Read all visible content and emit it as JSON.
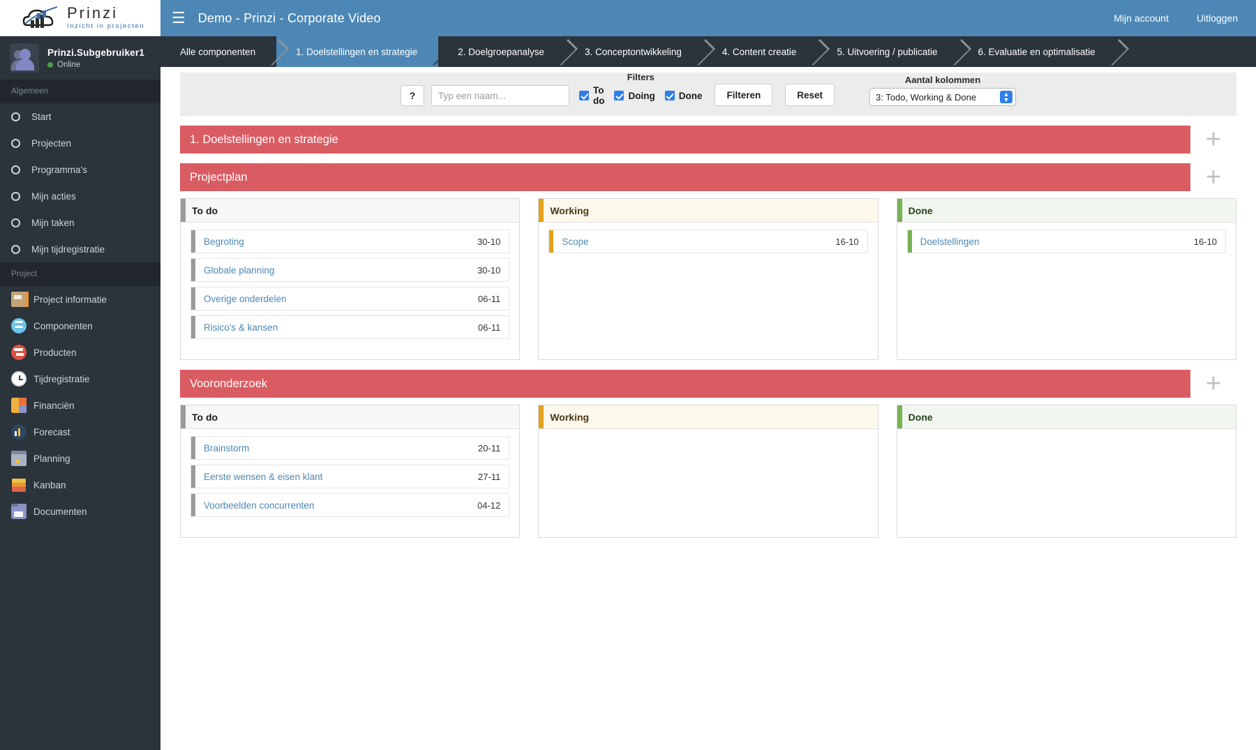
{
  "brand": {
    "title": "Prinzi",
    "tagline": "Inzicht in projecten"
  },
  "user": {
    "name": "Prinzi.Subgebruiker1",
    "status": "Online"
  },
  "topbar": {
    "app_title": "Demo - Prinzi - Corporate Video",
    "menu_icon": "hamburger-icon",
    "account_label": "Mijn account",
    "logout_label": "Uitloggen"
  },
  "sidebar": {
    "group_general_label": "Algemeen",
    "group_project_label": "Project",
    "general_items": [
      {
        "label": "Start",
        "icon": "circle-icon"
      },
      {
        "label": "Projecten",
        "icon": "circle-icon"
      },
      {
        "label": "Programma's",
        "icon": "circle-icon"
      },
      {
        "label": "Mijn acties",
        "icon": "circle-icon"
      },
      {
        "label": "Mijn taken",
        "icon": "circle-icon"
      },
      {
        "label": "Mijn tijdregistratie",
        "icon": "circle-icon"
      }
    ],
    "project_items": [
      {
        "label": "Project informatie",
        "icon": "notebook-icon"
      },
      {
        "label": "Componenten",
        "icon": "components-icon"
      },
      {
        "label": "Producten",
        "icon": "products-icon"
      },
      {
        "label": "Tijdregistratie",
        "icon": "stopwatch-icon"
      },
      {
        "label": "Financiën",
        "icon": "calculator-icon"
      },
      {
        "label": "Forecast",
        "icon": "bar-chart-icon"
      },
      {
        "label": "Planning",
        "icon": "calendar-icon"
      },
      {
        "label": "Kanban",
        "icon": "layers-icon"
      },
      {
        "label": "Documenten",
        "icon": "folder-icon"
      }
    ]
  },
  "breadcrumbs": [
    {
      "label": "Alle componenten",
      "active": false
    },
    {
      "label": "1. Doelstellingen en strategie",
      "active": true
    },
    {
      "label": "2. Doelgroepanalyse",
      "active": false
    },
    {
      "label": "3. Conceptontwikkeling",
      "active": false
    },
    {
      "label": "4. Content creatie",
      "active": false
    },
    {
      "label": "5. Uitvoering / publicatie",
      "active": false
    },
    {
      "label": "6. Evaluatie en optimalisatie",
      "active": false
    }
  ],
  "toolbar": {
    "help_label": "?",
    "search_placeholder": "Typ een naam...",
    "search_value": "",
    "filters_label": "Filters",
    "checkboxes": [
      {
        "label": "To do",
        "checked": true
      },
      {
        "label": "Doing",
        "checked": true
      },
      {
        "label": "Done",
        "checked": true
      }
    ],
    "filter_button": "Filteren",
    "reset_button": "Reset",
    "columns_label": "Aantal kolommen",
    "columns_value": "3: Todo, Working & Done"
  },
  "colors": {
    "phase_bar": "#da5c63",
    "topbar": "#4d87b5",
    "sidebar": "#2b333b",
    "todo_accent": "#9a9a9a",
    "working_accent": "#e3a11c",
    "done_accent": "#74b354",
    "link": "#4d87b5"
  },
  "board": {
    "phase_title": "1. Doelstellingen en strategie",
    "add_icon": "plus-icon",
    "components": [
      {
        "name": "Projectplan",
        "columns": [
          {
            "title": "To do",
            "kind": "todo",
            "cards": [
              {
                "title": "Begroting",
                "date": "30-10"
              },
              {
                "title": "Globale planning",
                "date": "30-10"
              },
              {
                "title": "Overige onderdelen",
                "date": "06-11"
              },
              {
                "title": "Risico's & kansen",
                "date": "06-11"
              }
            ]
          },
          {
            "title": "Working",
            "kind": "working",
            "cards": [
              {
                "title": "Scope",
                "date": "16-10"
              }
            ]
          },
          {
            "title": "Done",
            "kind": "done",
            "cards": [
              {
                "title": "Doelstellingen",
                "date": "16-10"
              }
            ]
          }
        ]
      },
      {
        "name": "Vooronderzoek",
        "columns": [
          {
            "title": "To do",
            "kind": "todo",
            "cards": [
              {
                "title": "Brainstorm",
                "date": "20-11"
              },
              {
                "title": "Eerste wensen & eisen klant",
                "date": "27-11"
              },
              {
                "title": "Voorbeelden concurrenten",
                "date": "04-12"
              }
            ]
          },
          {
            "title": "Working",
            "kind": "working",
            "cards": []
          },
          {
            "title": "Done",
            "kind": "done",
            "cards": []
          }
        ]
      }
    ]
  }
}
